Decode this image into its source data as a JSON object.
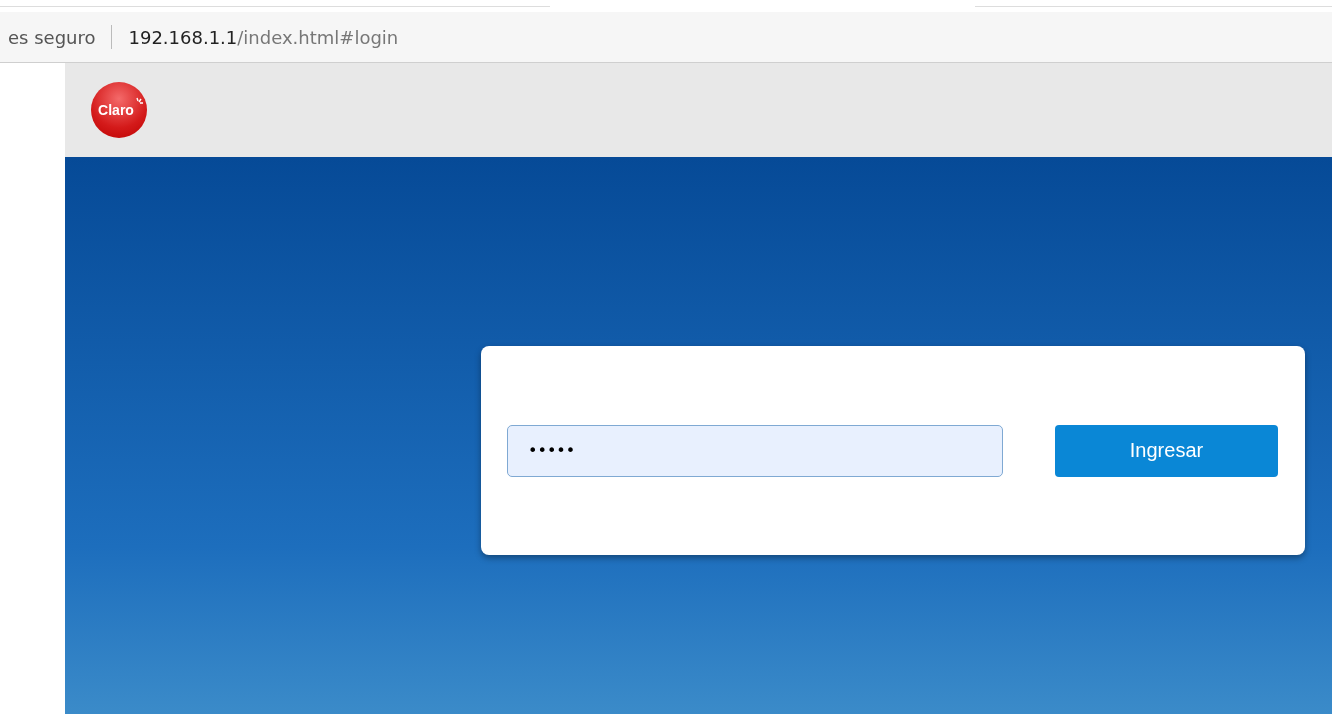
{
  "address_bar": {
    "security_text": "es seguro",
    "url_host": "192.168.1.1",
    "url_path": "/index.html#login"
  },
  "header": {
    "logo_text": "Claro"
  },
  "login": {
    "password_value": "•••••",
    "button": "Ingresar"
  }
}
